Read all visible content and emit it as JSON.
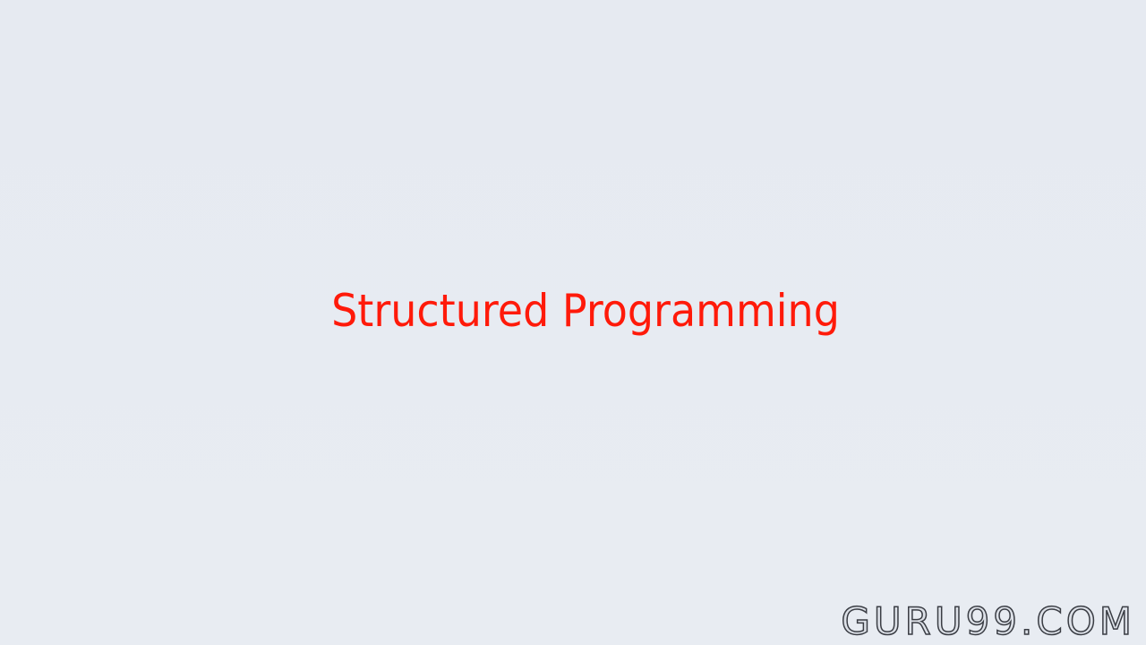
{
  "slide": {
    "title": "Structured Programming",
    "title_color": "#ff1a0a",
    "background_color": "#e7ebf1"
  },
  "watermark": {
    "text": "GURU99.COM"
  }
}
